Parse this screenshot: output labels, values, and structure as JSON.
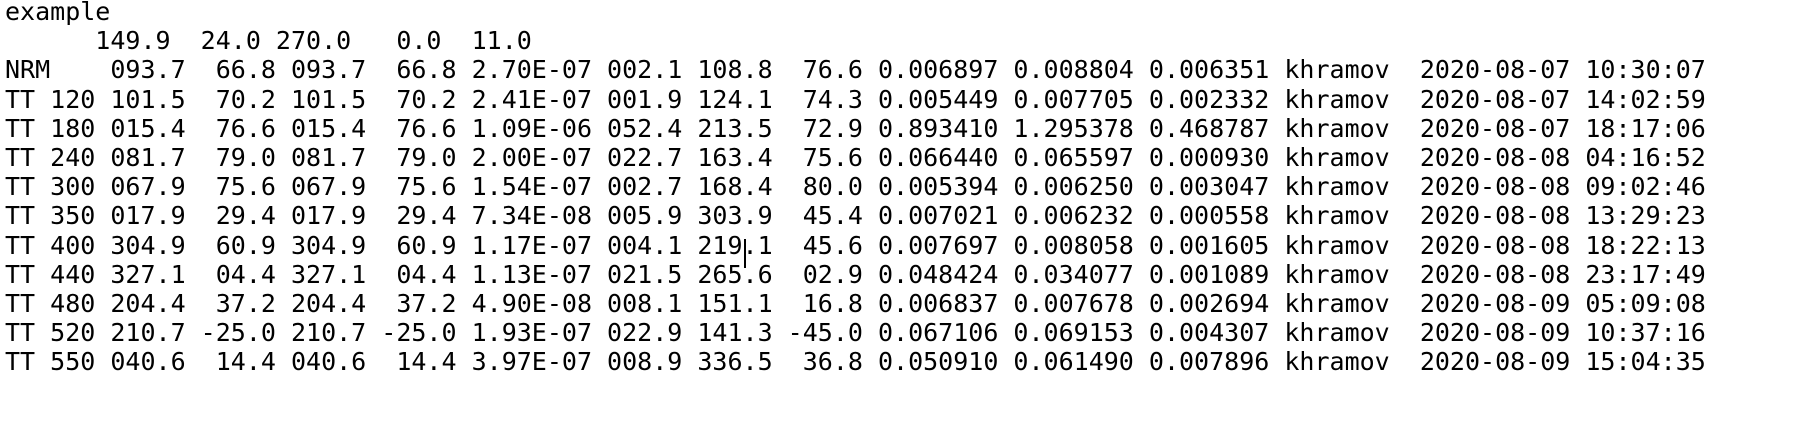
{
  "document": {
    "lines": [
      "example",
      "      149.9  24.0 270.0   0.0  11.0",
      "NRM    093.7  66.8 093.7  66.8 2.70E-07 002.1 108.8  76.6 0.006897 0.008804 0.006351 khramov  2020-08-07 10:30:07",
      "TT 120 101.5  70.2 101.5  70.2 2.41E-07 001.9 124.1  74.3 0.005449 0.007705 0.002332 khramov  2020-08-07 14:02:59",
      "TT 180 015.4  76.6 015.4  76.6 1.09E-06 052.4 213.5  72.9 0.893410 1.295378 0.468787 khramov  2020-08-07 18:17:06",
      "TT 240 081.7  79.0 081.7  79.0 2.00E-07 022.7 163.4  75.6 0.066440 0.065597 0.000930 khramov  2020-08-08 04:16:52",
      "TT 300 067.9  75.6 067.9  75.6 1.54E-07 002.7 168.4  80.0 0.005394 0.006250 0.003047 khramov  2020-08-08 09:02:46",
      "TT 350 017.9  29.4 017.9  29.4 7.34E-08 005.9 303.9  45.4 0.007021 0.006232 0.000558 khramov  2020-08-08 13:29:23",
      "TT 400 304.9  60.9 304.9  60.9 1.17E-07 004.1 219.1  45.6 0.007697 0.008058 0.001605 khramov  2020-08-08 18:22:13",
      "TT 440 327.1  04.4 327.1  04.4 1.13E-07 021.5 265.6  02.9 0.048424 0.034077 0.001089 khramov  2020-08-08 23:17:49",
      "TT 480 204.4  37.2 204.4  37.2 4.90E-08 008.1 151.1  16.8 0.006837 0.007678 0.002694 khramov  2020-08-09 05:09:08",
      "TT 520 210.7 -25.0 210.7 -25.0 1.93E-07 022.9 141.3 -45.0 0.067106 0.069153 0.004307 khramov  2020-08-09 10:37:16",
      "TT 550 040.6  14.4 040.6  14.4 3.97E-07 008.9 336.5  36.8 0.050910 0.061490 0.007896 khramov  2020-08-09 15:04:35"
    ]
  },
  "colors": {
    "background": "#ffffff",
    "text": "#000000"
  }
}
